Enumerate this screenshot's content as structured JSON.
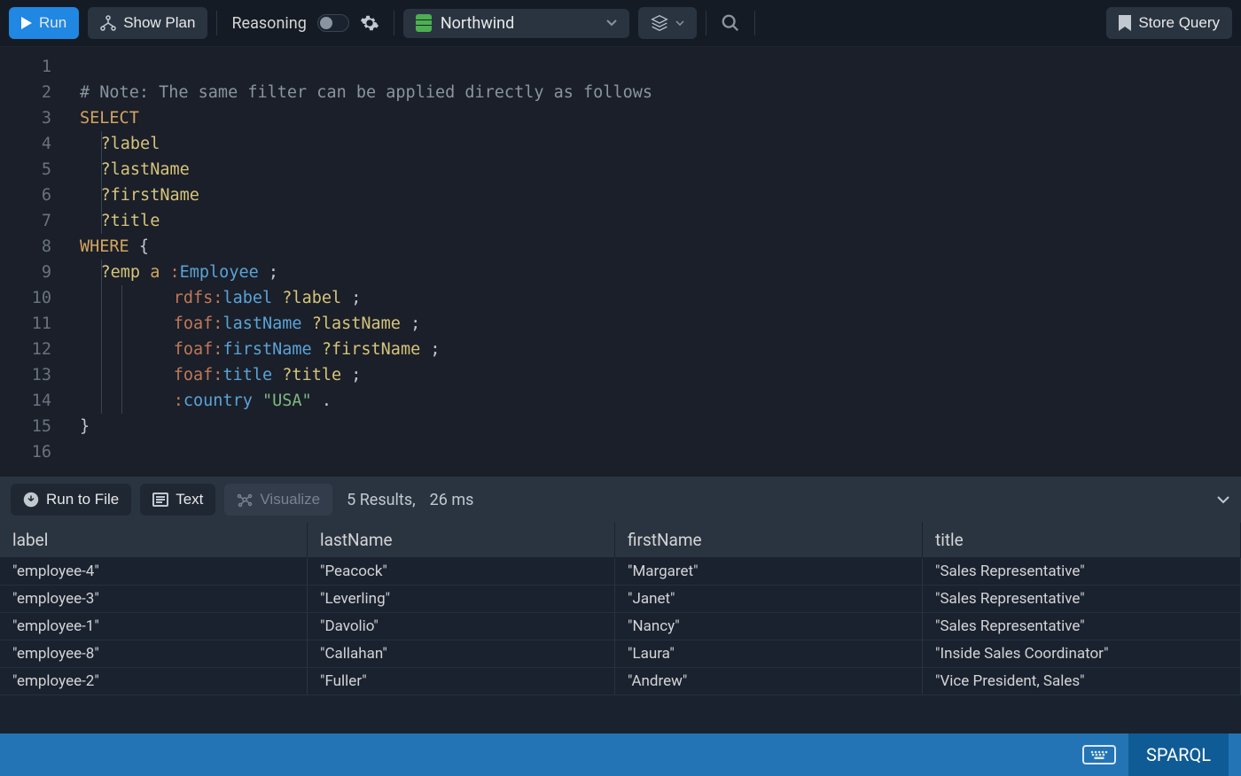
{
  "toolbar": {
    "run_label": "Run",
    "show_plan_label": "Show Plan",
    "reasoning_label": "Reasoning",
    "database": "Northwind",
    "store_query_label": "Store Query"
  },
  "editor": {
    "lines": [
      {
        "n": 1,
        "tokens": []
      },
      {
        "n": 2,
        "tokens": [
          {
            "t": "# Note: The same filter can be applied directly as follows",
            "c": "tok-comment"
          }
        ],
        "indent": 0
      },
      {
        "n": 3,
        "tokens": [
          {
            "t": "SELECT",
            "c": "tok-keyword"
          }
        ],
        "indent": 0
      },
      {
        "n": 4,
        "tokens": [
          {
            "t": "?label",
            "c": "tok-var"
          }
        ],
        "indent": 1
      },
      {
        "n": 5,
        "tokens": [
          {
            "t": "?lastName",
            "c": "tok-var"
          }
        ],
        "indent": 1
      },
      {
        "n": 6,
        "tokens": [
          {
            "t": "?firstName",
            "c": "tok-var"
          }
        ],
        "indent": 1
      },
      {
        "n": 7,
        "tokens": [
          {
            "t": "?title",
            "c": "tok-var"
          }
        ],
        "indent": 1
      },
      {
        "n": 8,
        "tokens": [
          {
            "t": "WHERE",
            "c": "tok-keyword"
          },
          {
            "t": " {",
            "c": "tok-punc"
          }
        ],
        "indent": 0
      },
      {
        "n": 9,
        "tokens": [
          {
            "t": "?emp",
            "c": "tok-var"
          },
          {
            "t": " ",
            "c": ""
          },
          {
            "t": "a",
            "c": "tok-a"
          },
          {
            "t": " ",
            "c": ""
          },
          {
            "t": ":",
            "c": "tok-prefix"
          },
          {
            "t": "Employee",
            "c": "tok-local"
          },
          {
            "t": " ;",
            "c": "tok-punc"
          }
        ],
        "indent": 1
      },
      {
        "n": 10,
        "tokens": [
          {
            "t": "rdfs:",
            "c": "tok-prefix"
          },
          {
            "t": "label",
            "c": "tok-local"
          },
          {
            "t": " ",
            "c": ""
          },
          {
            "t": "?label",
            "c": "tok-var"
          },
          {
            "t": " ;",
            "c": "tok-punc"
          }
        ],
        "indent": 4.5
      },
      {
        "n": 11,
        "tokens": [
          {
            "t": "foaf:",
            "c": "tok-prefix"
          },
          {
            "t": "lastName",
            "c": "tok-local"
          },
          {
            "t": " ",
            "c": ""
          },
          {
            "t": "?lastName",
            "c": "tok-var"
          },
          {
            "t": " ;",
            "c": "tok-punc"
          }
        ],
        "indent": 4.5
      },
      {
        "n": 12,
        "tokens": [
          {
            "t": "foaf:",
            "c": "tok-prefix"
          },
          {
            "t": "firstName",
            "c": "tok-local"
          },
          {
            "t": " ",
            "c": ""
          },
          {
            "t": "?firstName",
            "c": "tok-var"
          },
          {
            "t": " ;",
            "c": "tok-punc"
          }
        ],
        "indent": 4.5
      },
      {
        "n": 13,
        "tokens": [
          {
            "t": "foaf:",
            "c": "tok-prefix"
          },
          {
            "t": "title",
            "c": "tok-local"
          },
          {
            "t": " ",
            "c": ""
          },
          {
            "t": "?title",
            "c": "tok-var"
          },
          {
            "t": " ;",
            "c": "tok-punc"
          }
        ],
        "indent": 4.5
      },
      {
        "n": 14,
        "tokens": [
          {
            "t": ":",
            "c": "tok-prefix"
          },
          {
            "t": "country",
            "c": "tok-local"
          },
          {
            "t": " ",
            "c": ""
          },
          {
            "t": "\"USA\"",
            "c": "tok-string"
          },
          {
            "t": " .",
            "c": "tok-punc"
          }
        ],
        "indent": 4.5
      },
      {
        "n": 15,
        "tokens": [
          {
            "t": "}",
            "c": "tok-punc"
          }
        ],
        "indent": 0
      },
      {
        "n": 16,
        "tokens": [],
        "indent": 0
      }
    ]
  },
  "results_bar": {
    "run_to_file_label": "Run to File",
    "text_label": "Text",
    "visualize_label": "Visualize",
    "results_count": "5 Results,",
    "timing": "26 ms"
  },
  "results": {
    "columns": [
      "label",
      "lastName",
      "firstName",
      "title"
    ],
    "rows": [
      [
        "\"employee-4\"",
        "\"Peacock\"",
        "\"Margaret\"",
        "\"Sales Representative\""
      ],
      [
        "\"employee-3\"",
        "\"Leverling\"",
        "\"Janet\"",
        "\"Sales Representative\""
      ],
      [
        "\"employee-1\"",
        "\"Davolio\"",
        "\"Nancy\"",
        "\"Sales Representative\""
      ],
      [
        "\"employee-8\"",
        "\"Callahan\"",
        "\"Laura\"",
        "\"Inside Sales Coordinator\""
      ],
      [
        "\"employee-2\"",
        "\"Fuller\"",
        "\"Andrew\"",
        "\"Vice President, Sales\""
      ]
    ]
  },
  "status": {
    "language": "SPARQL"
  }
}
